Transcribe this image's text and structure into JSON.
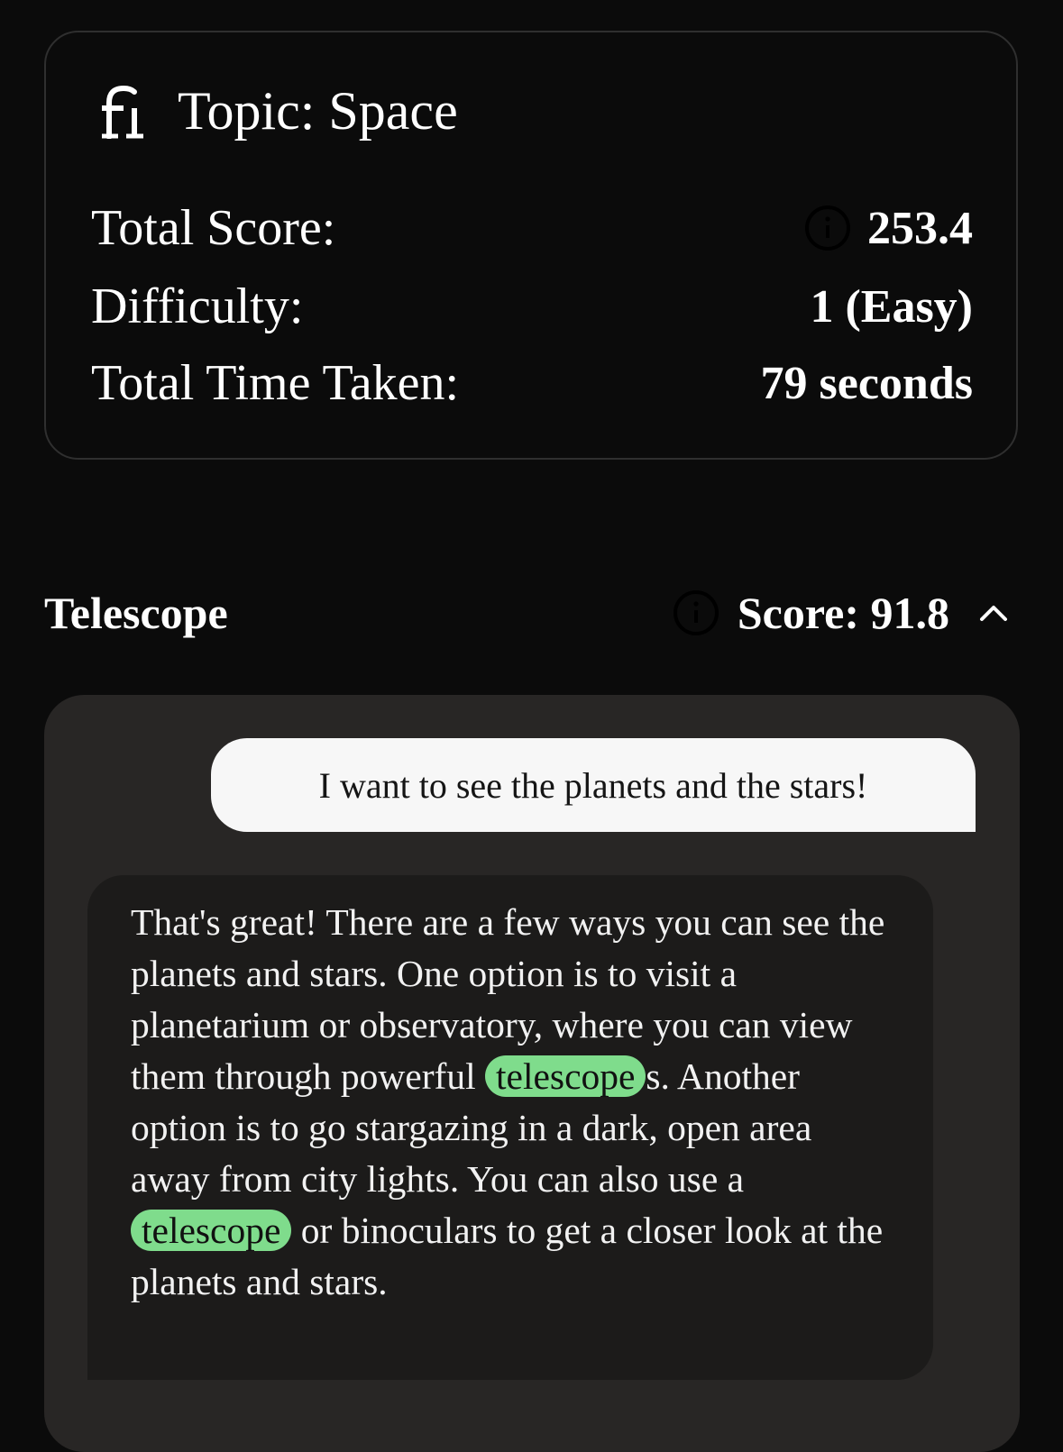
{
  "summary": {
    "topic_label": "Topic: Space",
    "total_score_label": "Total Score:",
    "total_score_value": "253.4",
    "difficulty_label": "Difficulty:",
    "difficulty_value": "1 (Easy)",
    "time_label": "Total Time Taken:",
    "time_value": "79 seconds"
  },
  "word": {
    "title": "Telescope",
    "score_text": "Score: 91.8",
    "expanded": true
  },
  "chat": {
    "user_message": "I want to see the planets and the stars!",
    "bot_segments": [
      "That's great! There are a few ways you can see the planets and stars. One option is to visit a planetarium or observatory, where you can view them through powerful ",
      "telescope",
      "s. Another option is to go stargazing in a dark, open area away from city lights. You can also use a ",
      "telescope",
      " or binoculars to get a closer look at the planets and stars."
    ]
  },
  "colors": {
    "page_background": "#0b0b0b",
    "chat_panel": "#282625",
    "bot_bubble": "#1c1b1a",
    "user_bubble": "#f7f7f7",
    "highlight": "#7fdc8c"
  },
  "icons": {
    "topic": "fi-ligature-icon",
    "info": "info-icon",
    "collapse": "chevron-up-icon"
  }
}
